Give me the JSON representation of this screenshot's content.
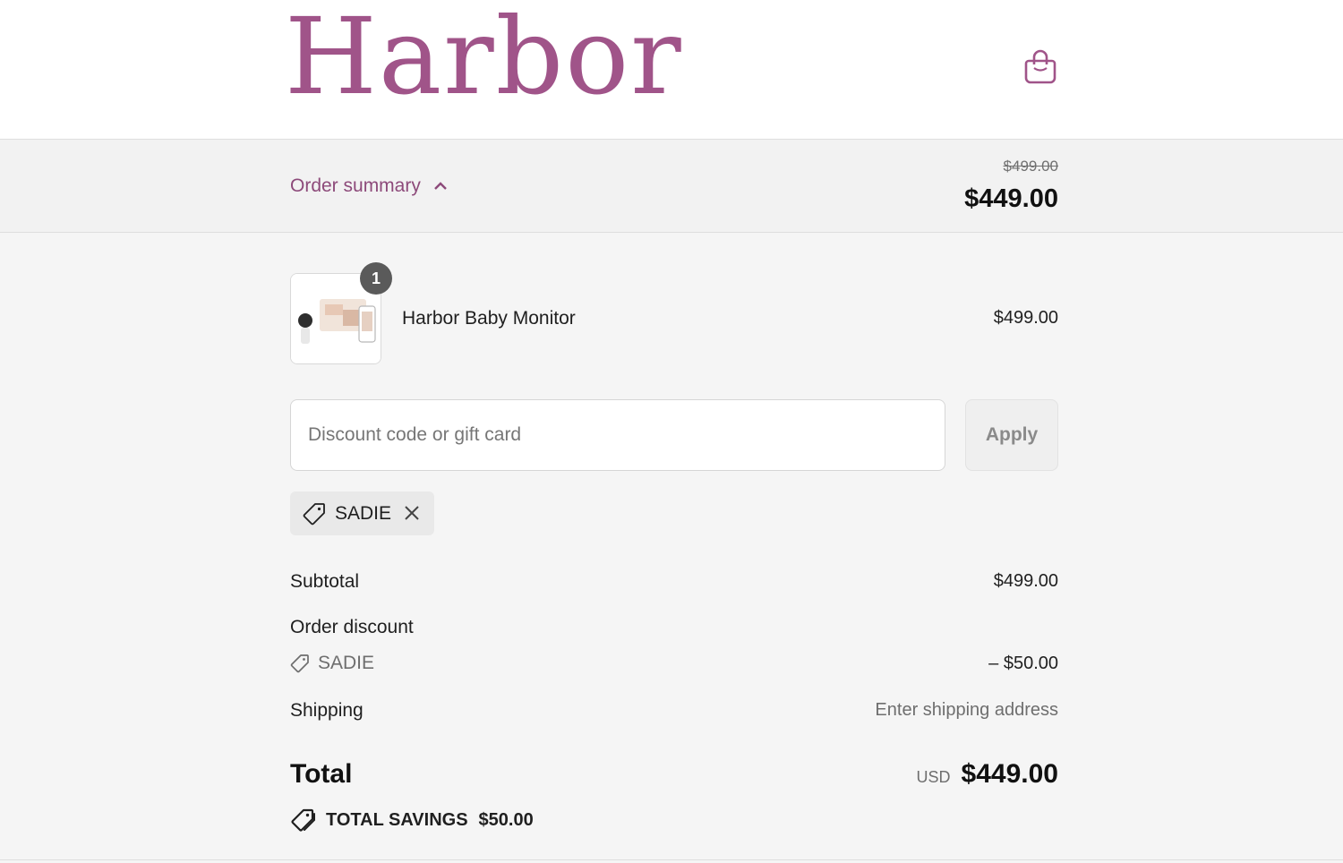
{
  "brand": {
    "name": "Harbor",
    "accent_color": "#a05489"
  },
  "header": {
    "cart_icon": "shopping-bag-icon"
  },
  "summary": {
    "toggle_label": "Order summary",
    "original_price": "$499.00",
    "price": "$449.00"
  },
  "line_items": [
    {
      "name": "Harbor Baby Monitor",
      "quantity": "1",
      "price": "$499.00"
    }
  ],
  "discount": {
    "placeholder": "Discount code or gift card",
    "value": "",
    "apply_label": "Apply",
    "applied_code": "SADIE"
  },
  "totals": {
    "subtotal_label": "Subtotal",
    "subtotal_value": "$499.00",
    "order_discount_label": "Order discount",
    "discount_code": "SADIE",
    "discount_value": "– $50.00",
    "shipping_label": "Shipping",
    "shipping_value": "Enter shipping address",
    "total_label": "Total",
    "currency": "USD",
    "total_value": "$449.00",
    "savings_label": "TOTAL SAVINGS",
    "savings_value": "$50.00"
  }
}
